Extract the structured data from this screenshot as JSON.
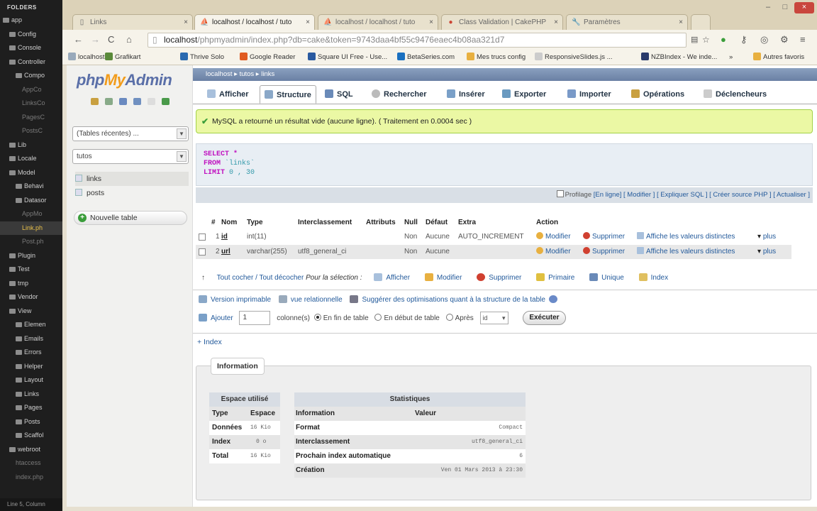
{
  "editor_sidebar": {
    "header": "FOLDERS",
    "items": [
      {
        "label": "app",
        "type": "folder"
      },
      {
        "label": "Config",
        "type": "folder"
      },
      {
        "label": "Console",
        "type": "folder"
      },
      {
        "label": "Controller",
        "type": "folder"
      },
      {
        "label": "Compo",
        "type": "folder"
      },
      {
        "label": "AppCo",
        "type": "file"
      },
      {
        "label": "LinksCo",
        "type": "file"
      },
      {
        "label": "PagesC",
        "type": "file"
      },
      {
        "label": "PostsC",
        "type": "file"
      },
      {
        "label": "Lib",
        "type": "folder"
      },
      {
        "label": "Locale",
        "type": "folder"
      },
      {
        "label": "Model",
        "type": "folder"
      },
      {
        "label": "Behavi",
        "type": "folder"
      },
      {
        "label": "Datasor",
        "type": "folder"
      },
      {
        "label": "AppMo",
        "type": "file"
      },
      {
        "label": "Link.ph",
        "type": "file",
        "selected": true
      },
      {
        "label": "Post.ph",
        "type": "file"
      },
      {
        "label": "Plugin",
        "type": "folder"
      },
      {
        "label": "Test",
        "type": "folder"
      },
      {
        "label": "tmp",
        "type": "folder"
      },
      {
        "label": "Vendor",
        "type": "folder"
      },
      {
        "label": "View",
        "type": "folder"
      },
      {
        "label": "Elemen",
        "type": "folder"
      },
      {
        "label": "Emails",
        "type": "folder"
      },
      {
        "label": "Errors",
        "type": "folder"
      },
      {
        "label": "Helper",
        "type": "folder"
      },
      {
        "label": "Layout",
        "type": "folder"
      },
      {
        "label": "Links",
        "type": "folder"
      },
      {
        "label": "Pages",
        "type": "folder"
      },
      {
        "label": "Posts",
        "type": "folder"
      },
      {
        "label": "Scaffol",
        "type": "folder"
      },
      {
        "label": "webroot",
        "type": "folder"
      },
      {
        "label": "htaccess",
        "type": "file"
      },
      {
        "label": "index.php",
        "type": "file"
      }
    ],
    "status": "Line 5, Column"
  },
  "browser": {
    "tabs": [
      {
        "label": "Links"
      },
      {
        "label": "localhost / localhost / tuto"
      },
      {
        "label": "localhost / localhost / tuto"
      },
      {
        "label": "Class Validation | CakePHP"
      },
      {
        "label": "Paramètres"
      }
    ],
    "tab_close": "×",
    "window_controls": {
      "minimize": "–",
      "maximize": "□",
      "close": "×"
    },
    "url_host": "localhost",
    "url_path": "/phpmyadmin/index.php?db=cake&token=9743daa4bf55c9476eaec4b08aa321d7",
    "bookmarks": [
      {
        "label": "localhost",
        "color": "#9ab"
      },
      {
        "label": "Grafikart",
        "color": "#5a8a3a"
      },
      {
        "label": "Thrive Solo",
        "color": "#2a6ab0"
      },
      {
        "label": "Google Reader",
        "color": "#e05a20"
      },
      {
        "label": "Square UI Free - Use...",
        "color": "#2a5aa0"
      },
      {
        "label": "BetaSeries.com",
        "color": "#1a70c0"
      },
      {
        "label": "Mes trucs config",
        "color": "#e8b040"
      },
      {
        "label": "ResponsiveSlides.js ...",
        "color": "#ccc"
      },
      {
        "label": "NZBIndex - We inde...",
        "color": "#2a3a6a"
      },
      {
        "label": "»",
        "color": ""
      },
      {
        "label": "Autres favoris",
        "color": "#e8b040"
      }
    ]
  },
  "pma": {
    "logo_php": "php",
    "logo_my": "My",
    "logo_admin": "Admin",
    "recent_tables": "(Tables récentes) ...",
    "db_select": "tutos",
    "tables": [
      "links",
      "posts"
    ],
    "new_table": "Nouvelle table",
    "breadcrumb": {
      "server": "localhost",
      "db": "tutos",
      "table": "links"
    },
    "tabs": [
      "Afficher",
      "Structure",
      "SQL",
      "Rechercher",
      "Insérer",
      "Exporter",
      "Importer",
      "Opérations",
      "Déclencheurs"
    ],
    "active_tab": "Structure",
    "success_msg": "MySQL a retourné un résultat vide (aucune ligne). ( Traitement en 0.0004 sec )",
    "sql": {
      "select": "SELECT",
      "star": "*",
      "from": "FROM",
      "table": "`links`",
      "limit": "LIMIT",
      "limit_val": "0 , 30"
    },
    "profiling": {
      "label": "Profilage",
      "links": [
        "[En ligne]",
        "[ Modifier ]",
        "[ Expliquer SQL ]",
        "[ Créer source PHP ]",
        "[ Actualiser ]"
      ]
    },
    "structure": {
      "headers": [
        "#",
        "Nom",
        "Type",
        "Interclassement",
        "Attributs",
        "Null",
        "Défaut",
        "Extra",
        "Action"
      ],
      "rows": [
        {
          "num": "1",
          "name": "id",
          "type": "int(11)",
          "collation": "",
          "attributes": "",
          "null": "Non",
          "default": "Aucune",
          "extra": "AUTO_INCREMENT"
        },
        {
          "num": "2",
          "name": "url",
          "type": "varchar(255)",
          "collation": "utf8_general_ci",
          "attributes": "",
          "null": "Non",
          "default": "Aucune",
          "extra": ""
        }
      ],
      "actions": {
        "modify": "Modifier",
        "delete": "Supprimer",
        "distinct": "Affiche les valeurs distinctes",
        "more": "plus"
      }
    },
    "check_row": {
      "check_all": "Tout cocher / Tout décocher",
      "selection": "Pour la sélection :",
      "buttons": [
        "Afficher",
        "Modifier",
        "Supprimer",
        "Primaire",
        "Unique",
        "Index"
      ]
    },
    "print_row": [
      "Version imprimable",
      "vue relationnelle",
      "Suggérer des optimisations quant à la structure de la table"
    ],
    "add_row": {
      "add": "Ajouter",
      "count": "1",
      "columns": "colonne(s)",
      "end": "En fin de table",
      "start": "En début de table",
      "after": "Après",
      "after_col": "id",
      "execute": "Exécuter"
    },
    "index_link": "+ Index",
    "info": {
      "legend": "Information",
      "space_title": "Espace utilisé",
      "space_headers": [
        "Type",
        "Espace"
      ],
      "space_rows": [
        {
          "type": "Données",
          "space": "16 Kio"
        },
        {
          "type": "Index",
          "space": "0 o"
        },
        {
          "type": "Total",
          "space": "16 Kio"
        }
      ],
      "stats_title": "Statistiques",
      "stats_headers": [
        "Information",
        "Valeur"
      ],
      "stats_rows": [
        {
          "info": "Format",
          "value": "Compact"
        },
        {
          "info": "Interclassement",
          "value": "utf8_general_ci"
        },
        {
          "info": "Prochain index automatique",
          "value": "6"
        },
        {
          "info": "Création",
          "value": "Ven 01 Mars 2013 à 23:30"
        }
      ]
    }
  }
}
